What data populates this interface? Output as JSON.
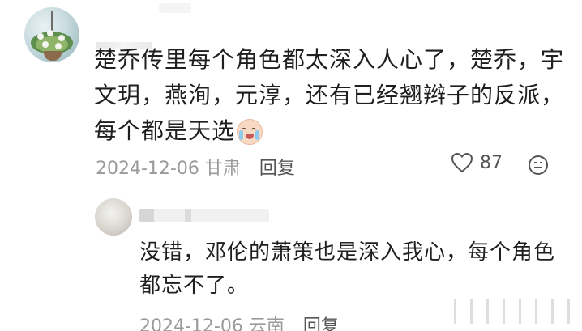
{
  "comment": {
    "text": "楚乔传里每个角色都太深入人心了，楚乔，宇文玥，燕洵，元淳，还有已经翘辫子的反派，每个都是天选",
    "emoji": "crying-laughing-emoji",
    "date": "2024-12-06",
    "location": "甘肃",
    "reply_label": "回复",
    "like_count": "87"
  },
  "reply": {
    "text": "没错，邓伦的萧策也是深入我心，每个角色都忘不了。",
    "date": "2024-12-06",
    "location": "云南",
    "reply_label": "回复"
  }
}
